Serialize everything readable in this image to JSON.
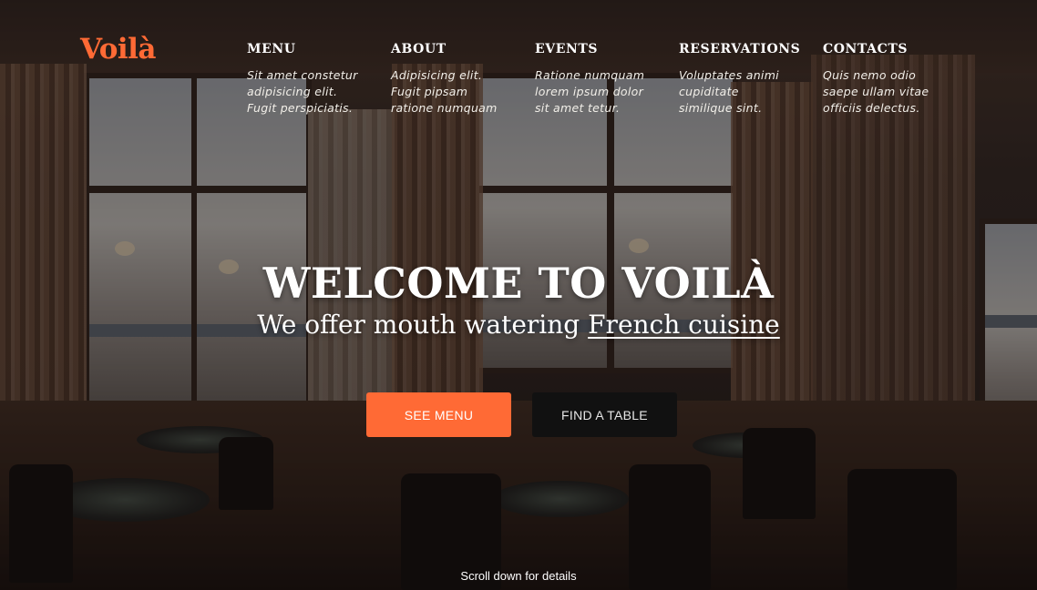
{
  "brand": {
    "logo": "Voilà",
    "accent": "#ff6a35"
  },
  "nav": {
    "items": [
      {
        "title": "MENU",
        "lines": [
          "Sit amet constetur",
          "adipisicing elit.",
          "Fugit perspiciatis."
        ]
      },
      {
        "title": "ABOUT",
        "lines": [
          "Adipisicing elit.",
          "Fugit pipsam",
          "ratione numquam"
        ]
      },
      {
        "title": "EVENTS",
        "lines": [
          "Ratione numquam",
          "lorem ipsum dolor",
          "sit amet tetur."
        ]
      },
      {
        "title": "RESERVATIONS",
        "lines": [
          "Voluptates animi",
          "cupiditate",
          "similique sint."
        ]
      },
      {
        "title": "CONTACTS",
        "lines": [
          "Quis nemo odio",
          "saepe ullam vitae",
          "officiis delectus."
        ]
      }
    ]
  },
  "hero": {
    "headline": "WELCOME TO VOILÀ",
    "subline_prefix": "We offer mouth watering ",
    "subline_link": "French cuisine",
    "primary_button": "SEE MENU",
    "secondary_button": "FIND A TABLE",
    "scroll_hint": "Scroll down for details"
  },
  "colors": {
    "primary_button": "#ff6a35",
    "secondary_button": "#111111"
  }
}
